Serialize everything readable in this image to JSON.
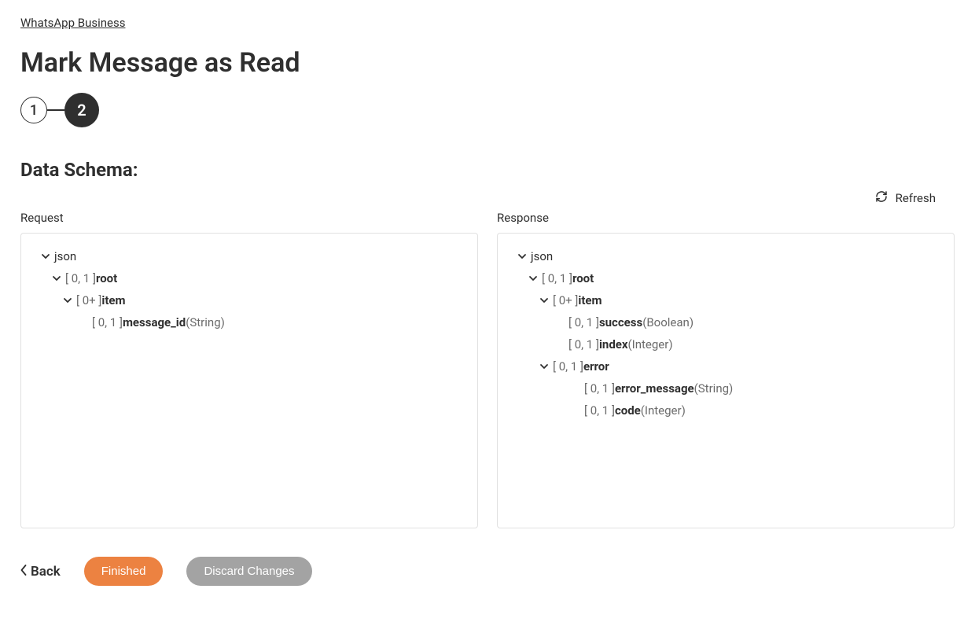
{
  "breadcrumb": "WhatsApp Business",
  "page_title": "Mark Message as Read",
  "stepper": {
    "step1": "1",
    "step2": "2"
  },
  "section_title": "Data Schema:",
  "refresh_label": "Refresh",
  "request": {
    "label": "Request",
    "rows": [
      {
        "card": "",
        "name": "json",
        "type": "",
        "indent": 0,
        "chev": true
      },
      {
        "card": "[ 0, 1 ] ",
        "name": "root",
        "type": "",
        "indent": 1,
        "chev": true
      },
      {
        "card": "[ 0+ ] ",
        "name": "item",
        "type": "",
        "indent": 2,
        "chev": true
      },
      {
        "card": "[ 0, 1 ] ",
        "name": "message_id",
        "type": " (String)",
        "indent": 3,
        "chev": false
      }
    ]
  },
  "response": {
    "label": "Response",
    "rows": [
      {
        "card": "",
        "name": "json",
        "type": "",
        "indent": 0,
        "chev": true
      },
      {
        "card": "[ 0, 1 ] ",
        "name": "root",
        "type": "",
        "indent": 1,
        "chev": true
      },
      {
        "card": "[ 0+ ] ",
        "name": "item",
        "type": "",
        "indent": 2,
        "chev": true
      },
      {
        "card": "[ 0, 1 ] ",
        "name": "success",
        "type": " (Boolean)",
        "indent": 3,
        "chev": false
      },
      {
        "card": "[ 0, 1 ] ",
        "name": "index",
        "type": " (Integer)",
        "indent": 3,
        "chev": false
      },
      {
        "card": "[ 0, 1 ] ",
        "name": "error",
        "type": "",
        "indent": 3,
        "chev": true,
        "chev_indent": 2
      },
      {
        "card": "[ 0, 1 ] ",
        "name": "error_message",
        "type": " (String)",
        "indent": 4,
        "chev": false
      },
      {
        "card": "[ 0, 1 ] ",
        "name": "code",
        "type": " (Integer)",
        "indent": 4,
        "chev": false
      }
    ]
  },
  "footer": {
    "back": "Back",
    "finished": "Finished",
    "discard": "Discard Changes"
  }
}
